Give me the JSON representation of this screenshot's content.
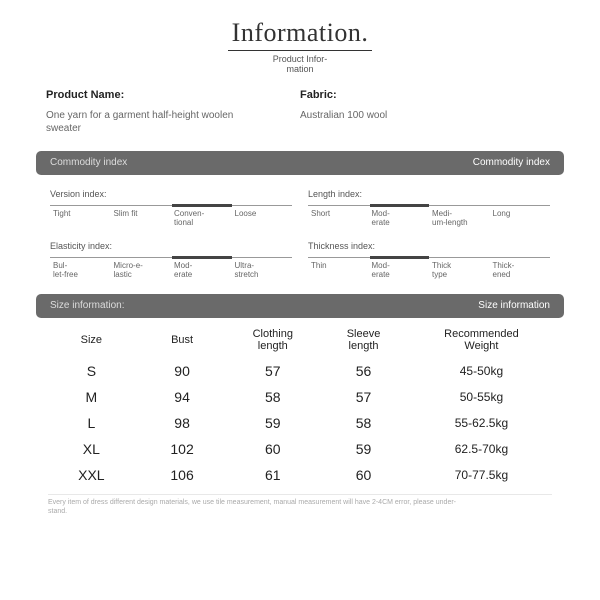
{
  "header": {
    "title": "Information.",
    "subtitle": "Product Infor-\nmation"
  },
  "product": {
    "name_label": "Product Name:",
    "name_value": "One yarn for a garment half-height woolen sweater",
    "fabric_label": "Fabric:",
    "fabric_value": "Australian 100 wool"
  },
  "bars": {
    "commodity_left": "Commodity index",
    "commodity_right": "Commodity index",
    "size_left": "Size information:",
    "size_right": "Size information"
  },
  "indexes": {
    "version": {
      "title": "Version index:",
      "options": [
        "Tight",
        "Slim fit",
        "Conven-\ntional",
        "Loose"
      ],
      "selected": 2
    },
    "length": {
      "title": "Length index:",
      "options": [
        "Short",
        "Mod-\nerate",
        "Medi-\num-length",
        "Long"
      ],
      "selected": 1
    },
    "elasticity": {
      "title": "Elasticity index:",
      "options": [
        "Bul-\nlet-free",
        "Micro-e-\nlastic",
        "Mod-\nerate",
        "Ultra-\nstretch"
      ],
      "selected": 2
    },
    "thickness": {
      "title": "Thickness index:",
      "options": [
        "Thin",
        "Mod-\nerate",
        "Thick\ntype",
        "Thick-\nened"
      ],
      "selected": 1
    }
  },
  "size_table": {
    "headers": [
      "Size",
      "Bust",
      "Clothing\nlength",
      "Sleeve\nlength",
      "Recommended\nWeight"
    ],
    "rows": [
      {
        "size": "S",
        "bust": "90",
        "clen": "57",
        "slen": "56",
        "weight": "45-50kg"
      },
      {
        "size": "M",
        "bust": "94",
        "clen": "58",
        "slen": "57",
        "weight": "50-55kg"
      },
      {
        "size": "L",
        "bust": "98",
        "clen": "59",
        "slen": "58",
        "weight": "55-62.5kg"
      },
      {
        "size": "XL",
        "bust": "102",
        "clen": "60",
        "slen": "59",
        "weight": "62.5-70kg"
      },
      {
        "size": "XXL",
        "bust": "106",
        "clen": "61",
        "slen": "60",
        "weight": "70-77.5kg"
      }
    ]
  },
  "footnote": "Every item of dress different design materials, we use tile measurement, manual measurement will have 2-4CM error, please under-\nstand."
}
